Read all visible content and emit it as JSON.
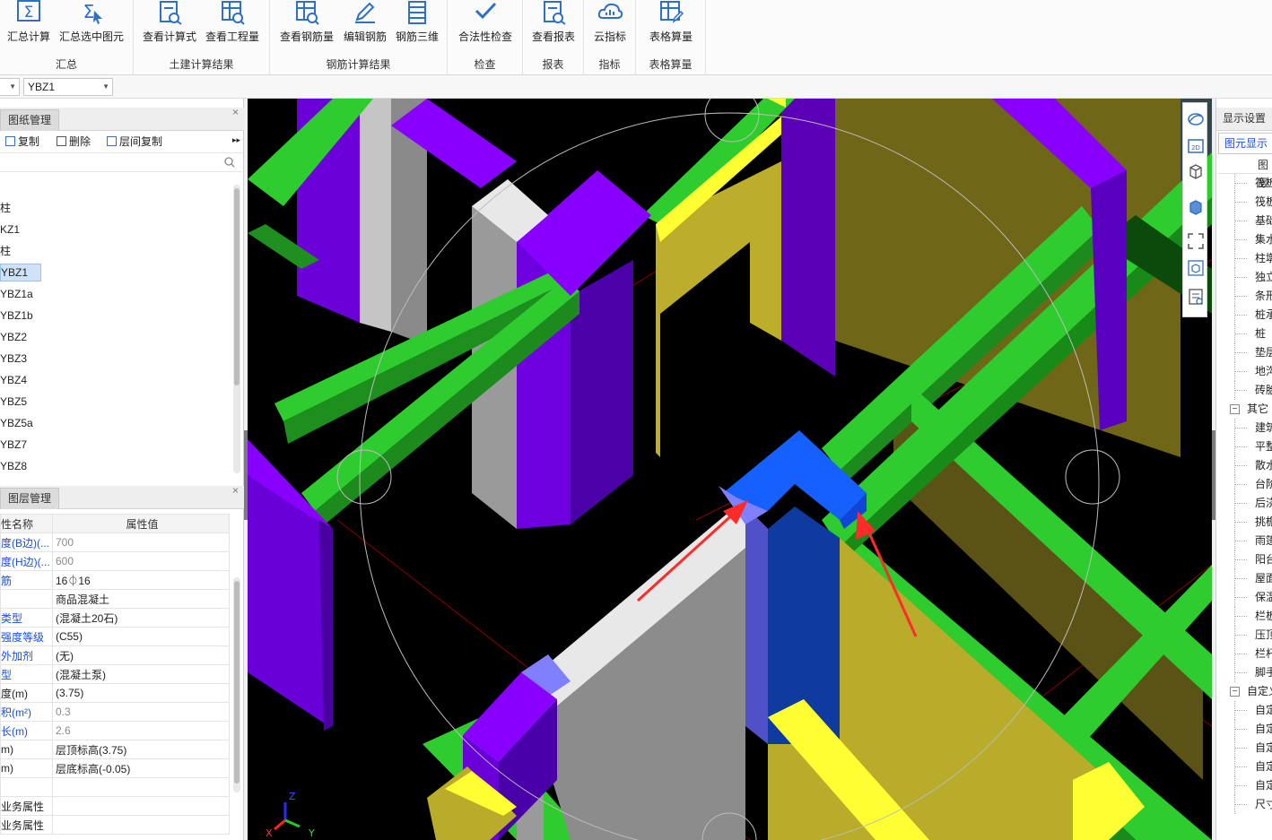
{
  "ribbon": {
    "groups": [
      {
        "title": "汇总",
        "buttons": [
          "汇总计算",
          "汇总选中图元"
        ]
      },
      {
        "title": "土建计算结果",
        "buttons": [
          "查看计算式",
          "查看工程量"
        ]
      },
      {
        "title": "钢筋计算结果",
        "buttons": [
          "查看钢筋量",
          "编辑钢筋",
          "钢筋三维"
        ]
      },
      {
        "title": "检查",
        "buttons": [
          "合法性检查"
        ]
      },
      {
        "title": "报表",
        "buttons": [
          "查看报表"
        ]
      },
      {
        "title": "指标",
        "buttons": [
          "云指标"
        ]
      },
      {
        "title": "表格算量",
        "buttons": [
          "表格算量"
        ]
      }
    ]
  },
  "selector": {
    "component": "YBZ1"
  },
  "drawing_panel": {
    "title": "图纸管理",
    "tools": {
      "copy": "复制",
      "delete": "删除",
      "floor_copy": "层间复制"
    },
    "tree": [
      "柱",
      "KZ1",
      "柱",
      "YBZ1",
      "YBZ1a",
      "YBZ1b",
      "YBZ2",
      "YBZ3",
      "YBZ4",
      "YBZ5",
      "YBZ5a",
      "YBZ7",
      "YBZ8"
    ],
    "selected_index": 3
  },
  "layer_panel": {
    "title": "图层管理",
    "header": {
      "name": "性名称",
      "value": "属性值"
    },
    "rows": [
      {
        "name": "度(B边)(...",
        "value": "700",
        "name_style": "blue",
        "value_style": "gray"
      },
      {
        "name": "度(H边)(...",
        "value": "600",
        "name_style": "blue",
        "value_style": "gray"
      },
      {
        "name": "筋",
        "value": "16⏀16",
        "name_style": "blue",
        "value_style": ""
      },
      {
        "name": "",
        "value": "商品混凝土",
        "name_style": "",
        "value_style": ""
      },
      {
        "name": "类型",
        "value": "(混凝土20石)",
        "name_style": "blue",
        "value_style": ""
      },
      {
        "name": "强度等级",
        "value": "(C55)",
        "name_style": "blue",
        "value_style": ""
      },
      {
        "name": "外加剂",
        "value": "(无)",
        "name_style": "blue",
        "value_style": ""
      },
      {
        "name": "型",
        "value": "(混凝土泵)",
        "name_style": "blue",
        "value_style": ""
      },
      {
        "name": "度(m)",
        "value": "(3.75)",
        "name_style": "",
        "value_style": ""
      },
      {
        "name": "积(m²)",
        "value": "0.3",
        "name_style": "blue",
        "value_style": "gray"
      },
      {
        "name": "长(m)",
        "value": "2.6",
        "name_style": "blue",
        "value_style": "gray"
      },
      {
        "name": "m)",
        "value": "层顶标高(3.75)",
        "name_style": "",
        "value_style": ""
      },
      {
        "name": "m)",
        "value": "层底标高(-0.05)",
        "name_style": "",
        "value_style": ""
      },
      {
        "name": "",
        "value": "",
        "name_style": "",
        "value_style": ""
      },
      {
        "name": "业务属性",
        "value": "",
        "name_style": "",
        "value_style": ""
      },
      {
        "name": "业务属性",
        "value": "",
        "name_style": "",
        "value_style": ""
      }
    ]
  },
  "right_panel": {
    "title": "显示设置",
    "tab": "图元显示",
    "column": "图层",
    "items": [
      {
        "text": "筏板",
        "group": false
      },
      {
        "text": "筏板",
        "group": false
      },
      {
        "text": "基础",
        "group": false
      },
      {
        "text": "集水",
        "group": false
      },
      {
        "text": "柱墩",
        "group": false
      },
      {
        "text": "独立",
        "group": false
      },
      {
        "text": "条形",
        "group": false
      },
      {
        "text": "桩承",
        "group": false
      },
      {
        "text": "桩",
        "group": false
      },
      {
        "text": "垫层",
        "group": false
      },
      {
        "text": "地沟",
        "group": false
      },
      {
        "text": "砖胎",
        "group": false
      },
      {
        "text": "其它",
        "group": true
      },
      {
        "text": "建筑",
        "group": false
      },
      {
        "text": "平整",
        "group": false
      },
      {
        "text": "散水",
        "group": false
      },
      {
        "text": "台阶",
        "group": false
      },
      {
        "text": "后浇",
        "group": false
      },
      {
        "text": "挑檐",
        "group": false
      },
      {
        "text": "雨篷",
        "group": false
      },
      {
        "text": "阳台",
        "group": false
      },
      {
        "text": "屋面",
        "group": false
      },
      {
        "text": "保温",
        "group": false
      },
      {
        "text": "栏板",
        "group": false
      },
      {
        "text": "压顶",
        "group": false
      },
      {
        "text": "栏杆",
        "group": false
      },
      {
        "text": "脚手",
        "group": false
      },
      {
        "text": "自定义",
        "group": true
      },
      {
        "text": "自定",
        "group": false
      },
      {
        "text": "自定",
        "group": false
      },
      {
        "text": "自定",
        "group": false
      },
      {
        "text": "自定",
        "group": false
      },
      {
        "text": "自定",
        "group": false
      },
      {
        "text": "尺寸",
        "group": false
      }
    ]
  },
  "view_tools": [
    "orbit-icon",
    "2d-icon",
    "cube-icon",
    "solid-cube-icon",
    "fit-screen-icon",
    "iso-view-icon",
    "properties-icon"
  ],
  "colors": {
    "beam_green": "#2ecc2e",
    "column_purple": "#7a00f0",
    "wall_yellow": "#b8ac2a",
    "selected_blue": "#1560ff",
    "arrow_red": "#ff2a2a"
  }
}
